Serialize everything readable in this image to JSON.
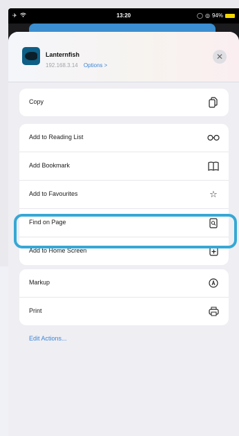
{
  "status_bar": {
    "time": "13:20",
    "battery_text": "94%"
  },
  "share_header": {
    "app_name": "Lanternfish",
    "address": "192.168.3.14",
    "options_label": "Options >"
  },
  "groups": [
    {
      "items": [
        {
          "label": "Copy",
          "icon": "copy-icon"
        }
      ]
    },
    {
      "items": [
        {
          "label": "Add to Reading List",
          "icon": "glasses-icon"
        },
        {
          "label": "Add Bookmark",
          "icon": "book-icon"
        },
        {
          "label": "Add to Favourites",
          "icon": "star-icon"
        },
        {
          "label": "Find on Page",
          "icon": "find-icon"
        },
        {
          "label": "Add to Home Screen",
          "icon": "plus-square-icon"
        }
      ]
    },
    {
      "items": [
        {
          "label": "Markup",
          "icon": "markup-icon"
        },
        {
          "label": "Print",
          "icon": "print-icon"
        }
      ]
    }
  ],
  "edit_actions_label": "Edit Actions...",
  "colors": {
    "highlight": "#36a8d5",
    "link": "#3a86d8",
    "battery": "#f2d600"
  }
}
